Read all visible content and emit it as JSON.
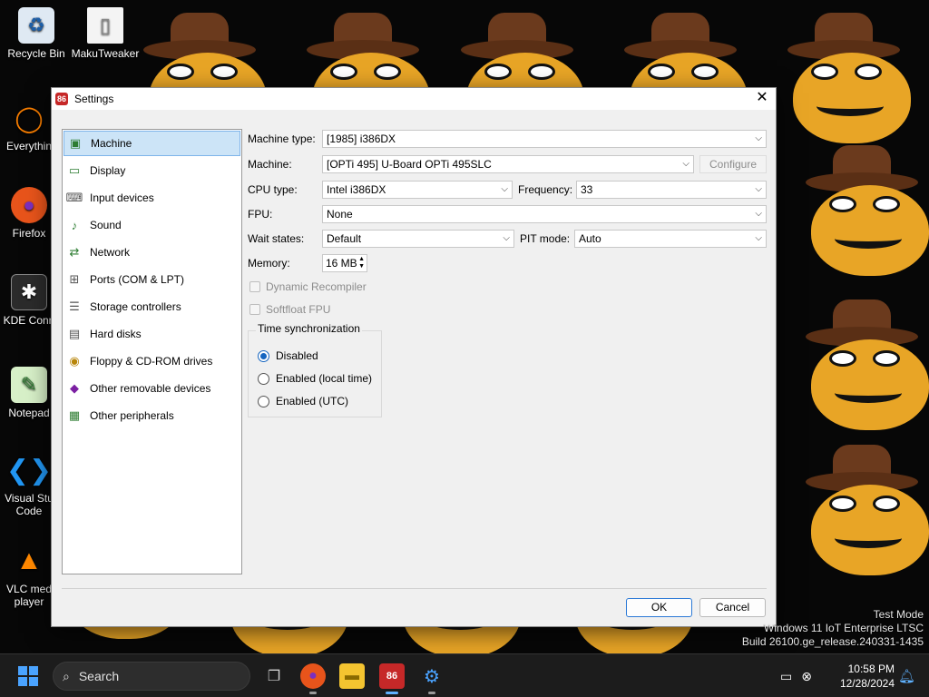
{
  "desktop": {
    "icons": [
      {
        "label": "Recycle Bin",
        "icon": "recycle-bin-icon"
      },
      {
        "label": "MakuTweaker",
        "icon": "file-icon"
      },
      {
        "label": "Everythin",
        "icon": "everything-search-icon"
      },
      {
        "label": "Firefox",
        "icon": "firefox-icon"
      },
      {
        "label": "KDE Conn",
        "icon": "kde-connect-icon"
      },
      {
        "label": "Notepad",
        "icon": "notepad-icon"
      },
      {
        "label": "Visual Stu Code",
        "icon": "vscode-icon"
      },
      {
        "label": "VLC med player",
        "icon": "vlc-icon"
      }
    ]
  },
  "window": {
    "title": "Settings",
    "close_glyph": "✕"
  },
  "sidebar": {
    "items": [
      {
        "label": "Machine",
        "icon": "machine-icon",
        "active": true
      },
      {
        "label": "Display",
        "icon": "display-icon"
      },
      {
        "label": "Input devices",
        "icon": "input-devices-icon"
      },
      {
        "label": "Sound",
        "icon": "sound-icon"
      },
      {
        "label": "Network",
        "icon": "network-icon"
      },
      {
        "label": "Ports (COM & LPT)",
        "icon": "ports-icon"
      },
      {
        "label": "Storage controllers",
        "icon": "storage-controllers-icon"
      },
      {
        "label": "Hard disks",
        "icon": "hard-disks-icon"
      },
      {
        "label": "Floppy & CD-ROM drives",
        "icon": "floppy-cdrom-icon"
      },
      {
        "label": "Other removable devices",
        "icon": "removable-devices-icon"
      },
      {
        "label": "Other peripherals",
        "icon": "peripherals-icon"
      }
    ]
  },
  "machine": {
    "machine_type_label": "Machine type:",
    "machine_type_value": "[1985] i386DX",
    "machine_label": "Machine:",
    "machine_value": "[OPTi 495] U-Board OPTi 495SLC",
    "configure_label": "Configure",
    "cpu_type_label": "CPU type:",
    "cpu_type_value": "Intel i386DX",
    "frequency_label": "Frequency:",
    "frequency_value": "33",
    "fpu_label": "FPU:",
    "fpu_value": "None",
    "wait_states_label": "Wait states:",
    "wait_states_value": "Default",
    "pit_mode_label": "PIT mode:",
    "pit_mode_value": "Auto",
    "memory_label": "Memory:",
    "memory_value": "16 MB",
    "dynamic_recompiler_label": "Dynamic Recompiler",
    "softfloat_label": "Softfloat FPU",
    "time_sync": {
      "title": "Time synchronization",
      "options": [
        "Disabled",
        "Enabled (local time)",
        "Enabled (UTC)"
      ],
      "selected": "Disabled"
    }
  },
  "buttons": {
    "ok": "OK",
    "cancel": "Cancel"
  },
  "watermark": {
    "line1": "Test Mode",
    "line2": "Windows 11 IoT Enterprise LTSC",
    "line3": "Build 26100.ge_release.240331-1435"
  },
  "taskbar": {
    "search_placeholder": "Search",
    "apps": [
      "task-view-icon",
      "firefox-icon",
      "file-explorer-icon",
      "86box-icon",
      "settings-icon"
    ],
    "time": "10:58 PM",
    "date": "12/28/2024"
  },
  "colors": {
    "accent": "#1565c0",
    "selection": "#cce4f7",
    "wallpaper_frog": "#e8a526",
    "wallpaper_hat": "#6b3a1d"
  }
}
